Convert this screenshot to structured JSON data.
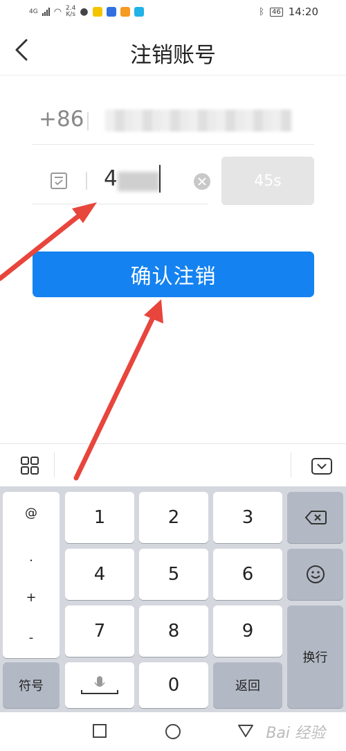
{
  "status_bar": {
    "network": "4G",
    "speed_top": "2.4",
    "speed_bottom": "K/s",
    "battery": "46",
    "time": "14:20"
  },
  "header": {
    "title": "注销账号"
  },
  "form": {
    "country_code": "+86",
    "code_value": "4",
    "timer_label": "45s"
  },
  "confirm_button": "确认注销",
  "keyboard": {
    "symbols": [
      "@",
      ".",
      "+",
      "-"
    ],
    "digits": [
      "1",
      "2",
      "3",
      "4",
      "5",
      "6",
      "7",
      "8",
      "9",
      "0"
    ],
    "symbol_key": "符号",
    "back_key": "返回",
    "enter_key": "换行"
  },
  "colors": {
    "accent": "#1482f0",
    "arrow": "#e8453c"
  },
  "watermark": "Bai 经验"
}
